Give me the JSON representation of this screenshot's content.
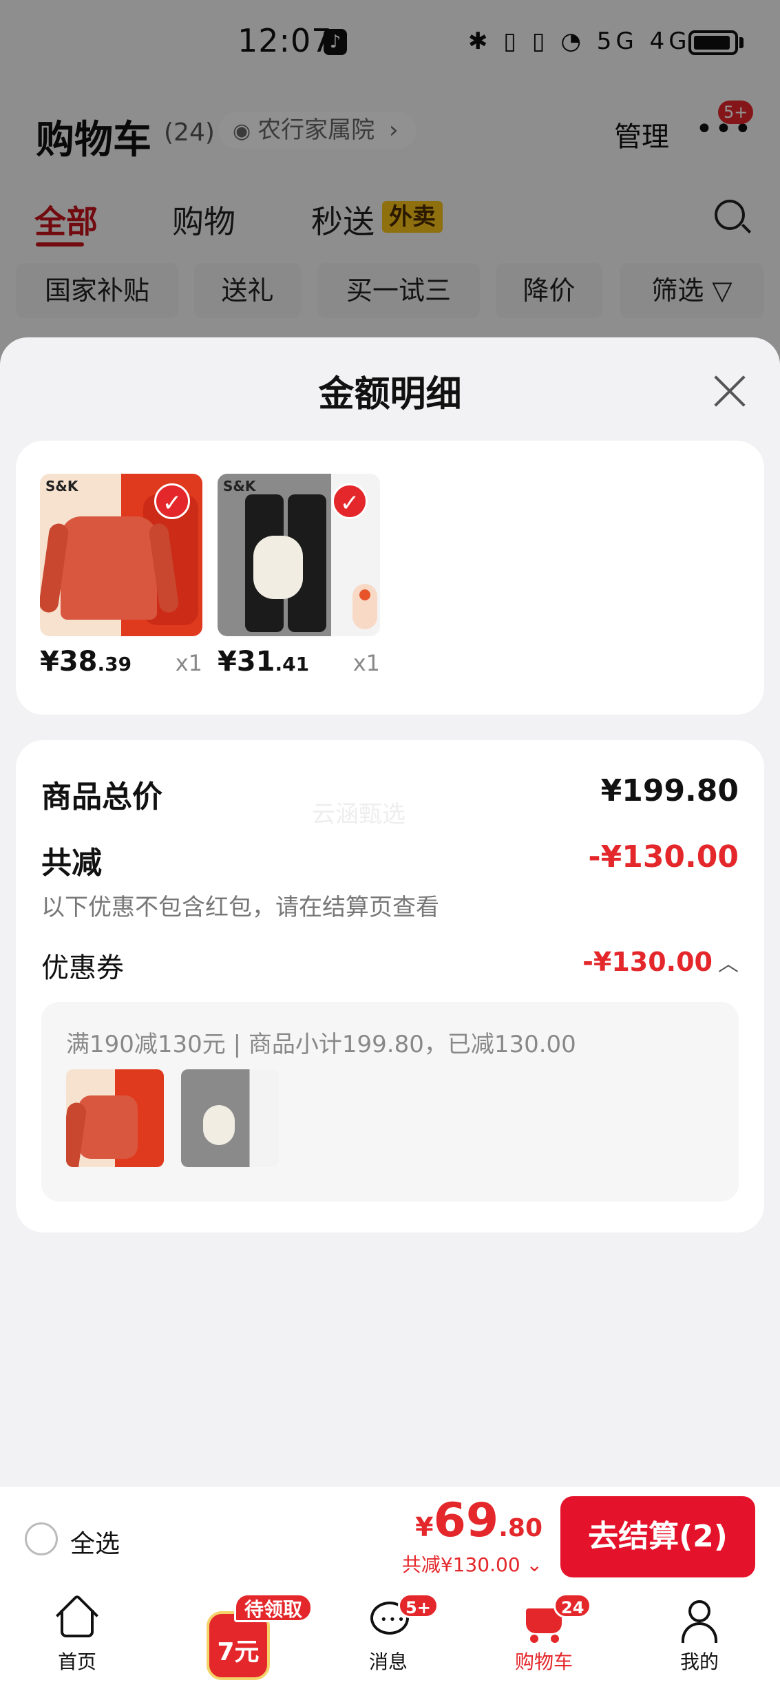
{
  "status_bar": {
    "time": "12:07",
    "app_badge_icon": "tiktok-icon",
    "icons_text": "✱ ▯ ▯ ◔ 5G 4G"
  },
  "header": {
    "title": "购物车",
    "count": "(24)",
    "address": "农行家属院",
    "address_chevron": "›",
    "manage": "管理",
    "more_icon": "•••",
    "more_badge": "5+"
  },
  "tabs": [
    {
      "label": "全部",
      "active": true
    },
    {
      "label": "购物",
      "active": false
    },
    {
      "label": "秒送",
      "active": false
    }
  ],
  "takeout_tag": "外卖",
  "filters": [
    {
      "label": "国家补贴"
    },
    {
      "label": "送礼"
    },
    {
      "label": "买一试三"
    },
    {
      "label": "降价"
    },
    {
      "label": "筛选 ▽"
    }
  ],
  "sheet": {
    "title": "金额明细",
    "products": [
      {
        "brand": "S&K",
        "price_int": "¥38",
        "price_dec": ".39",
        "qty": "x1",
        "checked": true
      },
      {
        "brand": "S&K",
        "price_int": "¥31",
        "price_dec": ".41",
        "qty": "x1",
        "checked": true
      }
    ],
    "watermark": "云涵甄选",
    "summary": {
      "total_label": "商品总价",
      "total_value": "¥199.80",
      "discount_label": "共减",
      "discount_value": "-¥130.00",
      "note": "以下优惠不包含红包，请在结算页查看",
      "coupon_label": "优惠券",
      "coupon_value": "-¥130.00",
      "coupon_chevron": "︿",
      "coupon_rule": "满190减130元 | 商品小计199.80，已减130.00"
    }
  },
  "checkout": {
    "select_all": "全选",
    "currency": "¥",
    "total_int": "69",
    "total_dec": ".80",
    "reduced": "共减¥130.00 ⌄",
    "button": "去结算(2)"
  },
  "tabbar": {
    "home": "首页",
    "promo_tag": "待领取",
    "promo_amount": "7元",
    "messages": "消息",
    "messages_badge": "5+",
    "cart": "购物车",
    "cart_badge": "24",
    "me": "我的"
  },
  "colors": {
    "accent_red": "#e4272b",
    "takeout_yellow": "#f4c21b"
  }
}
